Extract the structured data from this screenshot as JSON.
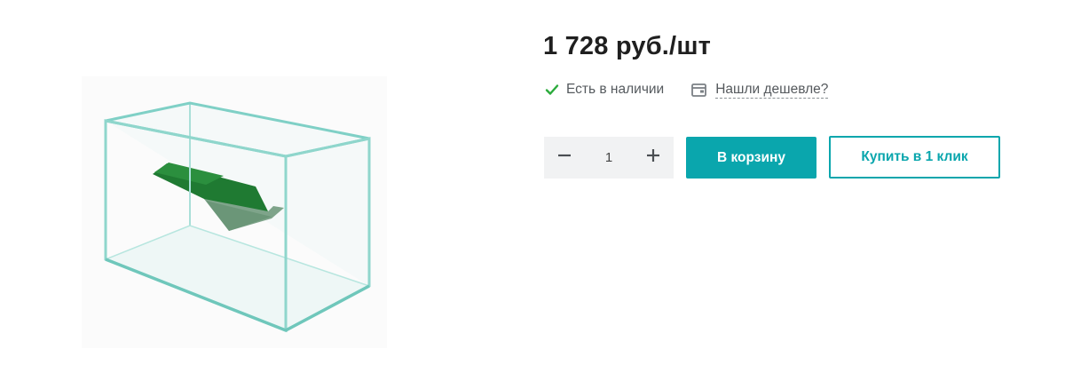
{
  "product": {
    "image_icon": "glass-terrarium-with-grass-ramp",
    "price": "1 728 руб./шт",
    "stock_status": "Есть в наличии",
    "cheaper_link": "Нашли дешевле?",
    "quantity": "1",
    "add_to_cart_label": "В корзину",
    "buy_one_click_label": "Купить в 1 клик"
  },
  "icons": {
    "stock": "check-icon",
    "cheaper": "wallet-icon",
    "minus": "minus-icon",
    "plus": "plus-icon"
  },
  "colors": {
    "accent": "#0aa6ad",
    "in_stock": "#2bab3c",
    "stepper_bg": "#f1f2f3",
    "price_text": "#1f1f1f"
  }
}
